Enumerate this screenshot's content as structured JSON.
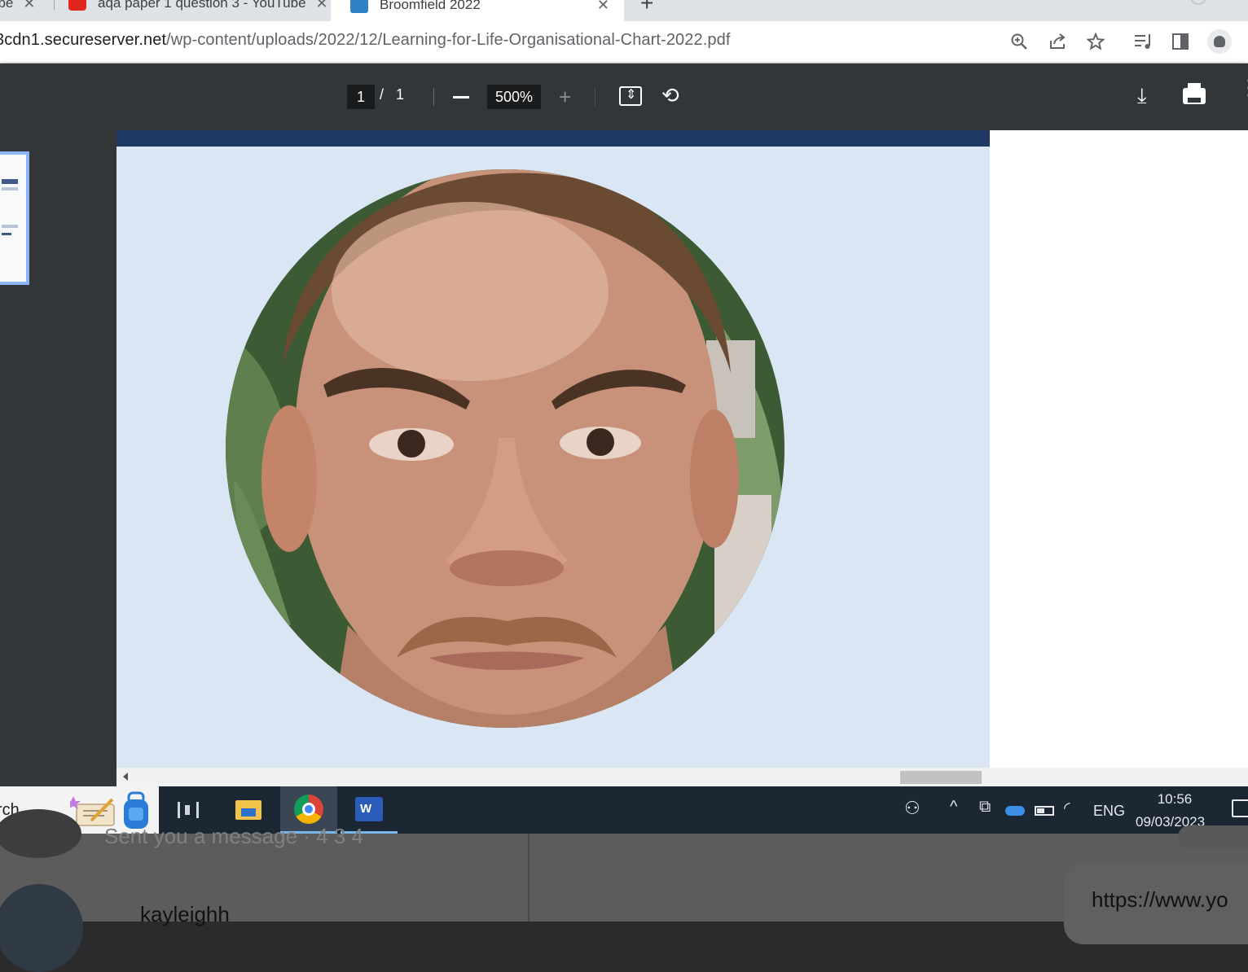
{
  "browser": {
    "tabs": [
      {
        "label": "ube",
        "close": "✕"
      },
      {
        "label": "aqa paper 1 question 3 - YouTube",
        "close": "✕"
      },
      {
        "label": "Broomfield 2022",
        "close": "✕",
        "active": true
      }
    ],
    "new_tab": "+",
    "address": {
      "host": "3cdn1.secureserver.net",
      "path": "/wp-content/uploads/2022/12/Learning-for-Life-Organisational-Chart-2022.pdf"
    },
    "toolbar_icons": [
      "zoom-icon",
      "share-icon",
      "star-icon",
      "reading-list-icon",
      "side-panel-icon",
      "profile-icon"
    ]
  },
  "pdf_viewer": {
    "page_current": "1",
    "page_separator": "/",
    "page_total": "1",
    "zoom": "500%",
    "zoom_out": "—",
    "zoom_in": "+",
    "icons": [
      "fit-page-icon",
      "rotate-icon",
      "download-icon",
      "print-icon",
      "more-icon"
    ],
    "colors": {
      "band": "#1f3864",
      "page_background": "#dae6f3"
    }
  },
  "taskbar": {
    "search_text": "rch",
    "tray": {
      "language": "ENG",
      "time": "10:56",
      "date": "09/03/2023"
    }
  },
  "background_app": {
    "preview": "Sent you a message · 4 3 4",
    "contact_name": "kayleighh",
    "link_text": "https://www.yo"
  }
}
